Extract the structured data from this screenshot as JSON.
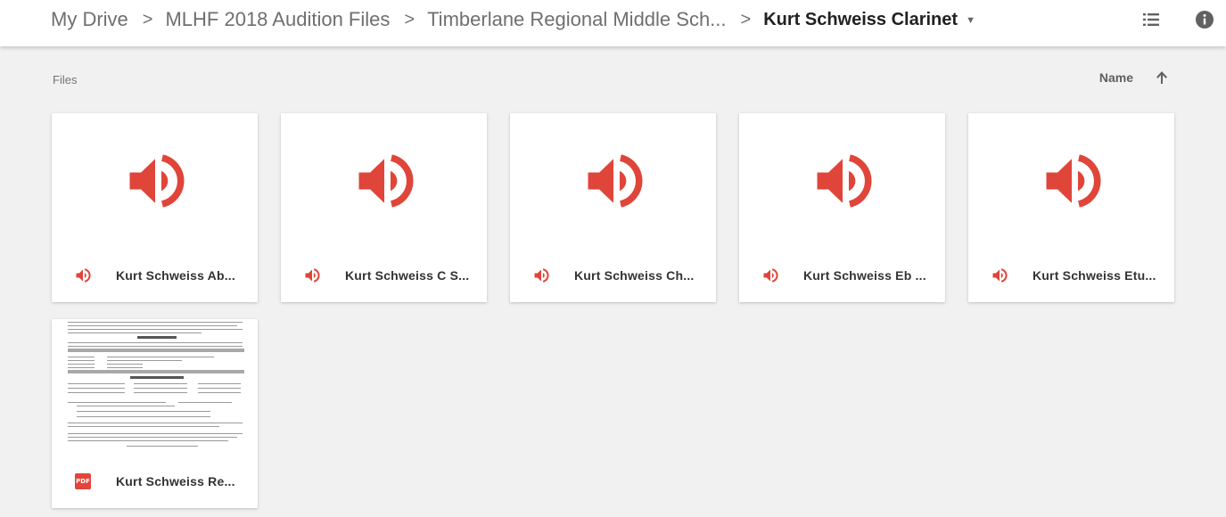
{
  "breadcrumb": {
    "items": [
      "My Drive",
      "MLHF 2018 Audition Files",
      "Timberlane Regional Middle Sch..."
    ],
    "separator": ">",
    "current": "Kurt Schweiss Clarinet"
  },
  "toolbar": {
    "list_view_icon": "list-view-icon",
    "details_icon": "info-icon"
  },
  "section": {
    "label": "Files"
  },
  "sort": {
    "label": "Name",
    "direction_icon": "arrow-up-icon"
  },
  "files": [
    {
      "name": "Kurt Schweiss Ab...",
      "type": "audio"
    },
    {
      "name": "Kurt Schweiss C S...",
      "type": "audio"
    },
    {
      "name": "Kurt Schweiss Ch...",
      "type": "audio"
    },
    {
      "name": "Kurt Schweiss Eb ...",
      "type": "audio"
    },
    {
      "name": "Kurt Schweiss Etu...",
      "type": "audio"
    },
    {
      "name": "Kurt Schweiss Re...",
      "type": "pdf",
      "badge": "PDF"
    }
  ],
  "colors": {
    "audio_icon": "#e0453a",
    "pdf_badge": "#e2453c",
    "background": "#f1f1f1"
  }
}
